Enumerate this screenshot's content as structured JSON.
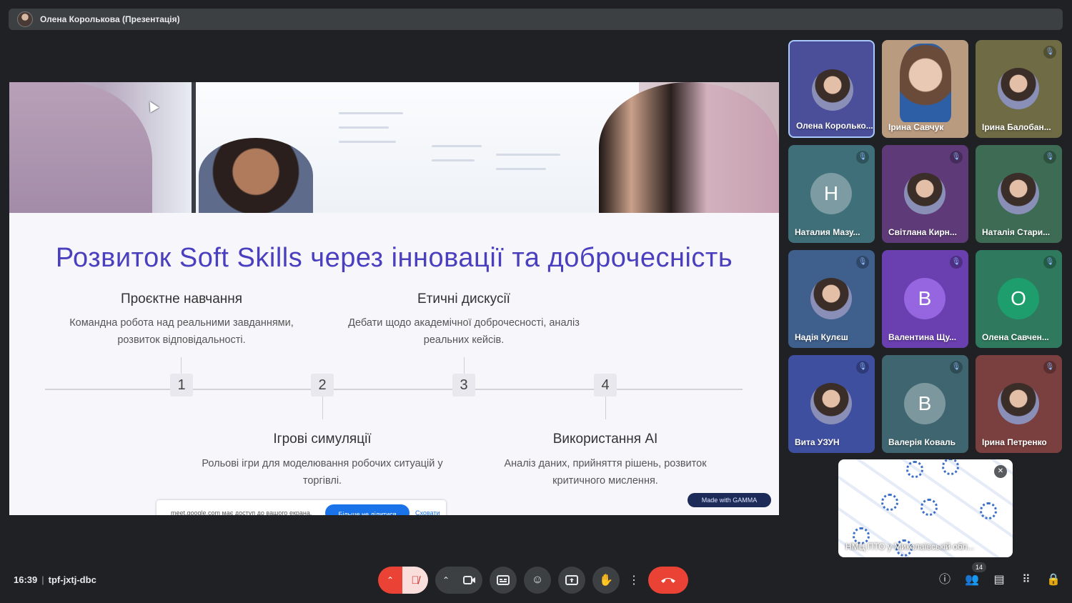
{
  "presenter": {
    "title": "Олена Королькова (Презентація)"
  },
  "slide": {
    "title": "Розвиток Soft Skills через інновації та доброчесність",
    "items": [
      {
        "step": "1",
        "title": "Проєктне навчання",
        "desc_line1": "Командна робота над реальними завданнями,",
        "desc_line2": "розвиток відповідальності."
      },
      {
        "step": "2",
        "title": "Ігрові симуляції",
        "desc_line1": "Рольові ігри для моделювання робочих ситуацій у",
        "desc_line2": "торгівлі."
      },
      {
        "step": "3",
        "title": "Етичні дискусії",
        "desc_line1": "Дебати щодо академічної доброчесності, аналіз",
        "desc_line2": "реальних кейсів."
      },
      {
        "step": "4",
        "title": "Використання AI",
        "desc_line1": "Аналіз даних, прийняття рішень, розвиток",
        "desc_line2": "критичного мислення."
      }
    ],
    "badge": "Made with GAMMA"
  },
  "share_notice": {
    "text": "meet.google.com має доступ до вашого екрана.",
    "stop_label": "Більше не ділитися",
    "hide_label": "Сховати"
  },
  "participants": [
    {
      "name": "Олена Королько...",
      "type": "photo",
      "active": true,
      "bg": "#4b4f9a"
    },
    {
      "name": "Ірина Савчук",
      "type": "video",
      "bg": "#b99b80"
    },
    {
      "name": "Ірина Балобан...",
      "type": "photo",
      "bg": "#6e6b45",
      "muted": true
    },
    {
      "name": "Наталия Мазу...",
      "type": "letter",
      "letter": "Н",
      "bg": "#3f6f78",
      "avatar_bg": "#7d9ba3",
      "muted": true
    },
    {
      "name": "Світлана Кирн...",
      "type": "photo",
      "bg": "#5e3b78",
      "muted": true
    },
    {
      "name": "Наталія Стари...",
      "type": "photo",
      "bg": "#3d6b54",
      "muted": true
    },
    {
      "name": "Надія Кулєш",
      "type": "photo",
      "bg": "#3f5f8c",
      "muted": true
    },
    {
      "name": "Валентина Щу...",
      "type": "letter",
      "letter": "В",
      "bg": "#6a3fb0",
      "avatar_bg": "#9566e0",
      "muted": true
    },
    {
      "name": "Олена Савчен...",
      "type": "letter",
      "letter": "О",
      "bg": "#2f7a5f",
      "avatar_bg": "#1d9e6c",
      "muted": true
    },
    {
      "name": "Вита УЗУН",
      "type": "photo",
      "bg": "#3f4fa0",
      "muted": true
    },
    {
      "name": "Валерія Коваль",
      "type": "letter",
      "letter": "В",
      "bg": "#3f6670",
      "avatar_bg": "#7d979e",
      "muted": true
    },
    {
      "name": "Ірина Петренко",
      "type": "photo",
      "bg": "#7a3f3f",
      "muted": true
    }
  ],
  "self_view": {
    "label": "НМЦ ПТО у Миколаївській обл..."
  },
  "meeting": {
    "time": "16:39",
    "code": "tpf-jxtj-dbc",
    "people_count": "14"
  },
  "colors": {
    "end_call": "#ea4335",
    "mic_off": "#f9dedc",
    "accent": "#4a3fbf"
  }
}
